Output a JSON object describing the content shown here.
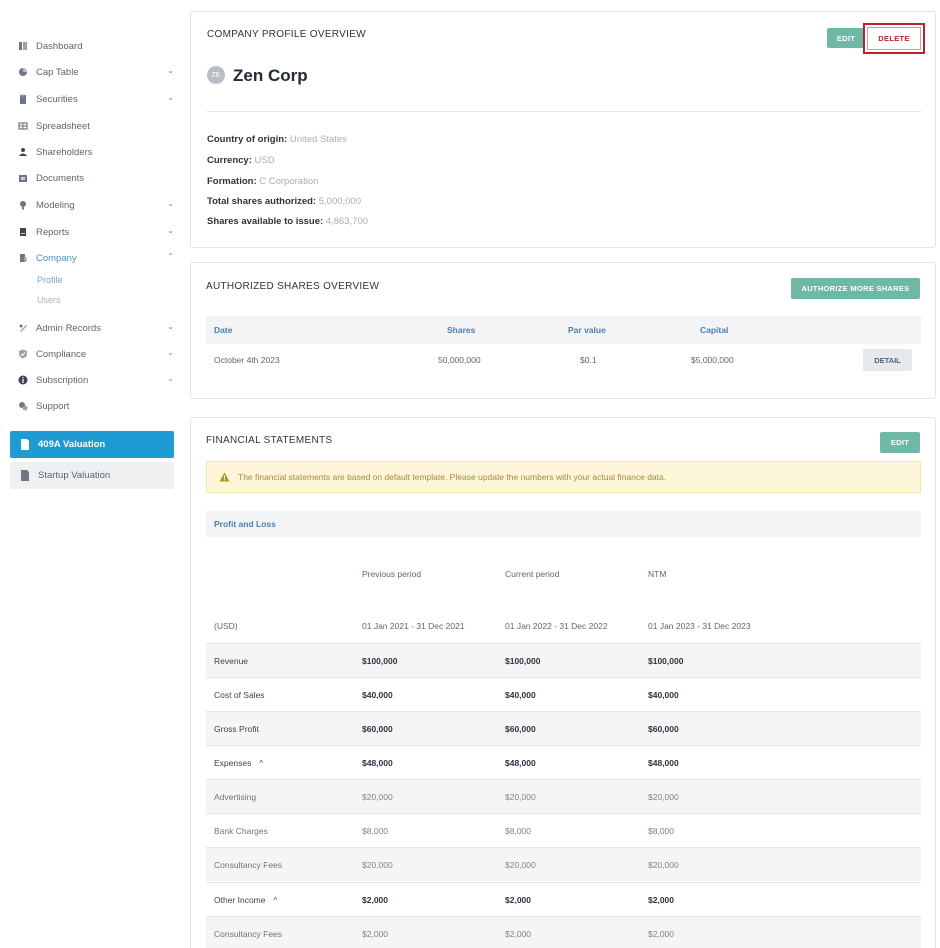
{
  "sidebar": {
    "items": [
      {
        "label": "Dashboard",
        "icon": "dashboard-icon",
        "chevron": ""
      },
      {
        "label": "Cap Table",
        "icon": "pie-chart-icon",
        "chevron": "⌄"
      },
      {
        "label": "Securities",
        "icon": "clipboard-icon",
        "chevron": "⌄"
      },
      {
        "label": "Spreadsheet",
        "icon": "spreadsheet-icon",
        "chevron": ""
      },
      {
        "label": "Shareholders",
        "icon": "person-icon",
        "chevron": ""
      },
      {
        "label": "Documents",
        "icon": "documents-icon",
        "chevron": ""
      },
      {
        "label": "Modeling",
        "icon": "lightbulb-icon",
        "chevron": "⌄"
      },
      {
        "label": "Reports",
        "icon": "report-icon",
        "chevron": "⌄"
      },
      {
        "label": "Company",
        "icon": "building-icon",
        "chevron": "⌃"
      },
      {
        "label": "Admin Records",
        "icon": "admin-icon",
        "chevron": "⌄"
      },
      {
        "label": "Compliance",
        "icon": "shield-icon",
        "chevron": "⌄"
      },
      {
        "label": "Subscription",
        "icon": "info-icon",
        "chevron": "⌄"
      },
      {
        "label": "Support",
        "icon": "support-icon",
        "chevron": ""
      }
    ],
    "company_sub": {
      "profile": "Profile",
      "users": "Users"
    },
    "valuation_409a": "409A Valuation",
    "startup_valuation": "Startup Valuation"
  },
  "profile_card": {
    "title": "COMPANY PROFILE OVERVIEW",
    "edit_label": "EDIT",
    "delete_label": "DELETE",
    "avatar_initials": "ZE",
    "company_name": "Zen Corp",
    "fields": [
      {
        "key": "Country of origin:",
        "value": "United States"
      },
      {
        "key": "Currency:",
        "value": "USD"
      },
      {
        "key": "Formation:",
        "value": "C Corporation"
      },
      {
        "key": "Total shares authorized:",
        "value": "5,000,000"
      },
      {
        "key": "Shares available to issue:",
        "value": "4,863,700"
      }
    ]
  },
  "authorized_card": {
    "title": "AUTHORIZED SHARES OVERVIEW",
    "authorize_label": "AUTHORIZE MORE SHARES",
    "columns": {
      "date": "Date",
      "shares": "Shares",
      "par": "Par value",
      "capital": "Capital"
    },
    "row": {
      "date": "October 4th 2023",
      "shares": "50,000,000",
      "par": "$0.1",
      "capital": "$5,000,000",
      "detail_label": "DETAIL"
    }
  },
  "financial_card": {
    "title": "FINANCIAL STATEMENTS",
    "edit_label": "EDIT",
    "notice": "The financial statements are based on default template. Please update the numbers with your actual finance data.",
    "section_label": "Profit and Loss",
    "periods": [
      "Previous period",
      "Current period",
      "NTM"
    ],
    "unit_label": "(USD)",
    "period_ranges": [
      "01 Jan 2021 - 31 Dec 2021",
      "01 Jan 2022 - 31 Dec 2022",
      "01 Jan 2023 - 31 Dec 2023"
    ],
    "rows": [
      {
        "label": "Revenue",
        "values": [
          "$100,000",
          "$100,000",
          "$100,000"
        ],
        "kind": "main"
      },
      {
        "label": "Cost of Sales",
        "values": [
          "$40,000",
          "$40,000",
          "$40,000"
        ],
        "kind": "main"
      },
      {
        "label": "Gross Profit",
        "values": [
          "$60,000",
          "$60,000",
          "$60,000"
        ],
        "kind": "main"
      },
      {
        "label": "Expenses",
        "values": [
          "$48,000",
          "$48,000",
          "$48,000"
        ],
        "kind": "group"
      },
      {
        "label": "Advertising",
        "values": [
          "$20,000",
          "$20,000",
          "$20,000"
        ],
        "kind": "sub"
      },
      {
        "label": "Bank Charges",
        "values": [
          "$8,000",
          "$8,000",
          "$8,000"
        ],
        "kind": "sub"
      },
      {
        "label": "Consultancy Fees",
        "values": [
          "$20,000",
          "$20,000",
          "$20,000"
        ],
        "kind": "sub"
      },
      {
        "label": "Other Income",
        "values": [
          "$2,000",
          "$2,000",
          "$2,000"
        ],
        "kind": "group"
      },
      {
        "label": "Consultancy Fees",
        "values": [
          "$2,000",
          "$2,000",
          "$2,000"
        ],
        "kind": "sub"
      }
    ],
    "caret": "^"
  },
  "colors": {
    "teal_button": "#6fb8a6",
    "primary_blue": "#1e9bd2",
    "delete_red": "#b3262f",
    "notice_bg": "#fdf6d8"
  }
}
